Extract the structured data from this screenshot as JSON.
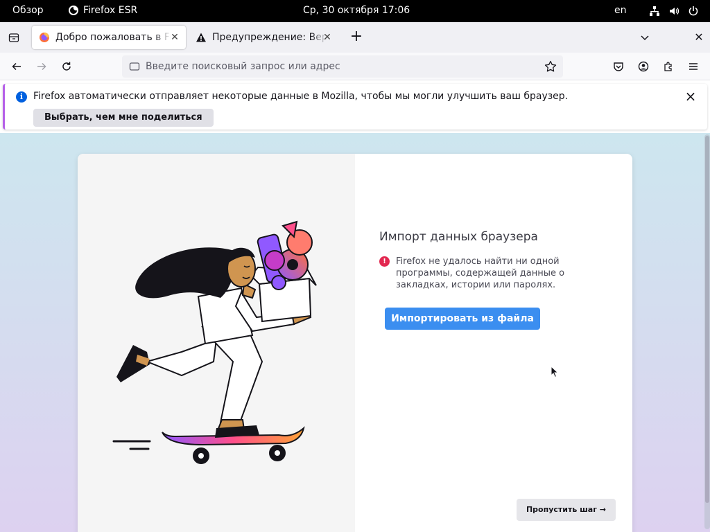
{
  "topbar": {
    "overview": "Обзор",
    "app_name": "Firefox ESR",
    "clock": "Ср, 30 октября  17:06",
    "lang": "en",
    "tray_icons": [
      "network-icon",
      "volume-icon",
      "power-icon"
    ]
  },
  "tabs": [
    {
      "title": "Добро пожаловать в Firefox",
      "icon": "firefox-icon",
      "active": true
    },
    {
      "title": "Предупреждение: Вероятная угроза",
      "icon": "warning-icon",
      "active": false
    }
  ],
  "urlbar": {
    "placeholder": "Введите поисковый запрос или адрес"
  },
  "notification": {
    "message": "Firefox автоматически отправляет некоторые данные в Mozilla, чтобы мы могли улучшить ваш браузер.",
    "action": "Выбрать, чем мне поделиться"
  },
  "onboarding": {
    "heading": "Импорт данных браузера",
    "error": "Firefox не удалось найти ни одной программы, содержащей данные о закладках, истории или паролях.",
    "import_button": "Импортировать из файла",
    "skip_button": "Пропустить шаг →"
  },
  "colors": {
    "accent": "#0060df",
    "primary_button": "#3b8ef0",
    "error": "#e22850",
    "notification_border": "#b560e8"
  }
}
